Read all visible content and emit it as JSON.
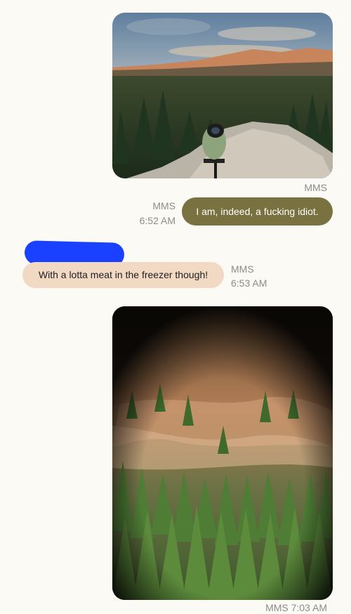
{
  "messages": [
    {
      "type": "image",
      "direction": "outgoing",
      "label": "MMS"
    },
    {
      "type": "text",
      "direction": "outgoing",
      "label": "MMS",
      "time": "6:52 AM",
      "text": "I am, indeed, a fucking idiot."
    },
    {
      "type": "text",
      "direction": "incoming",
      "label": "MMS",
      "time": "6:53 AM",
      "text": "With a lotta meat in the freezer though!"
    },
    {
      "type": "image",
      "direction": "incoming",
      "label": "MMS",
      "time": "7:03 AM"
    }
  ],
  "colors": {
    "background": "#fbfaf5",
    "outgoing_bubble": "#7a7140",
    "incoming_bubble": "#f1d9c3",
    "redaction": "#1a41ff",
    "meta_text": "#8c8c8c"
  }
}
